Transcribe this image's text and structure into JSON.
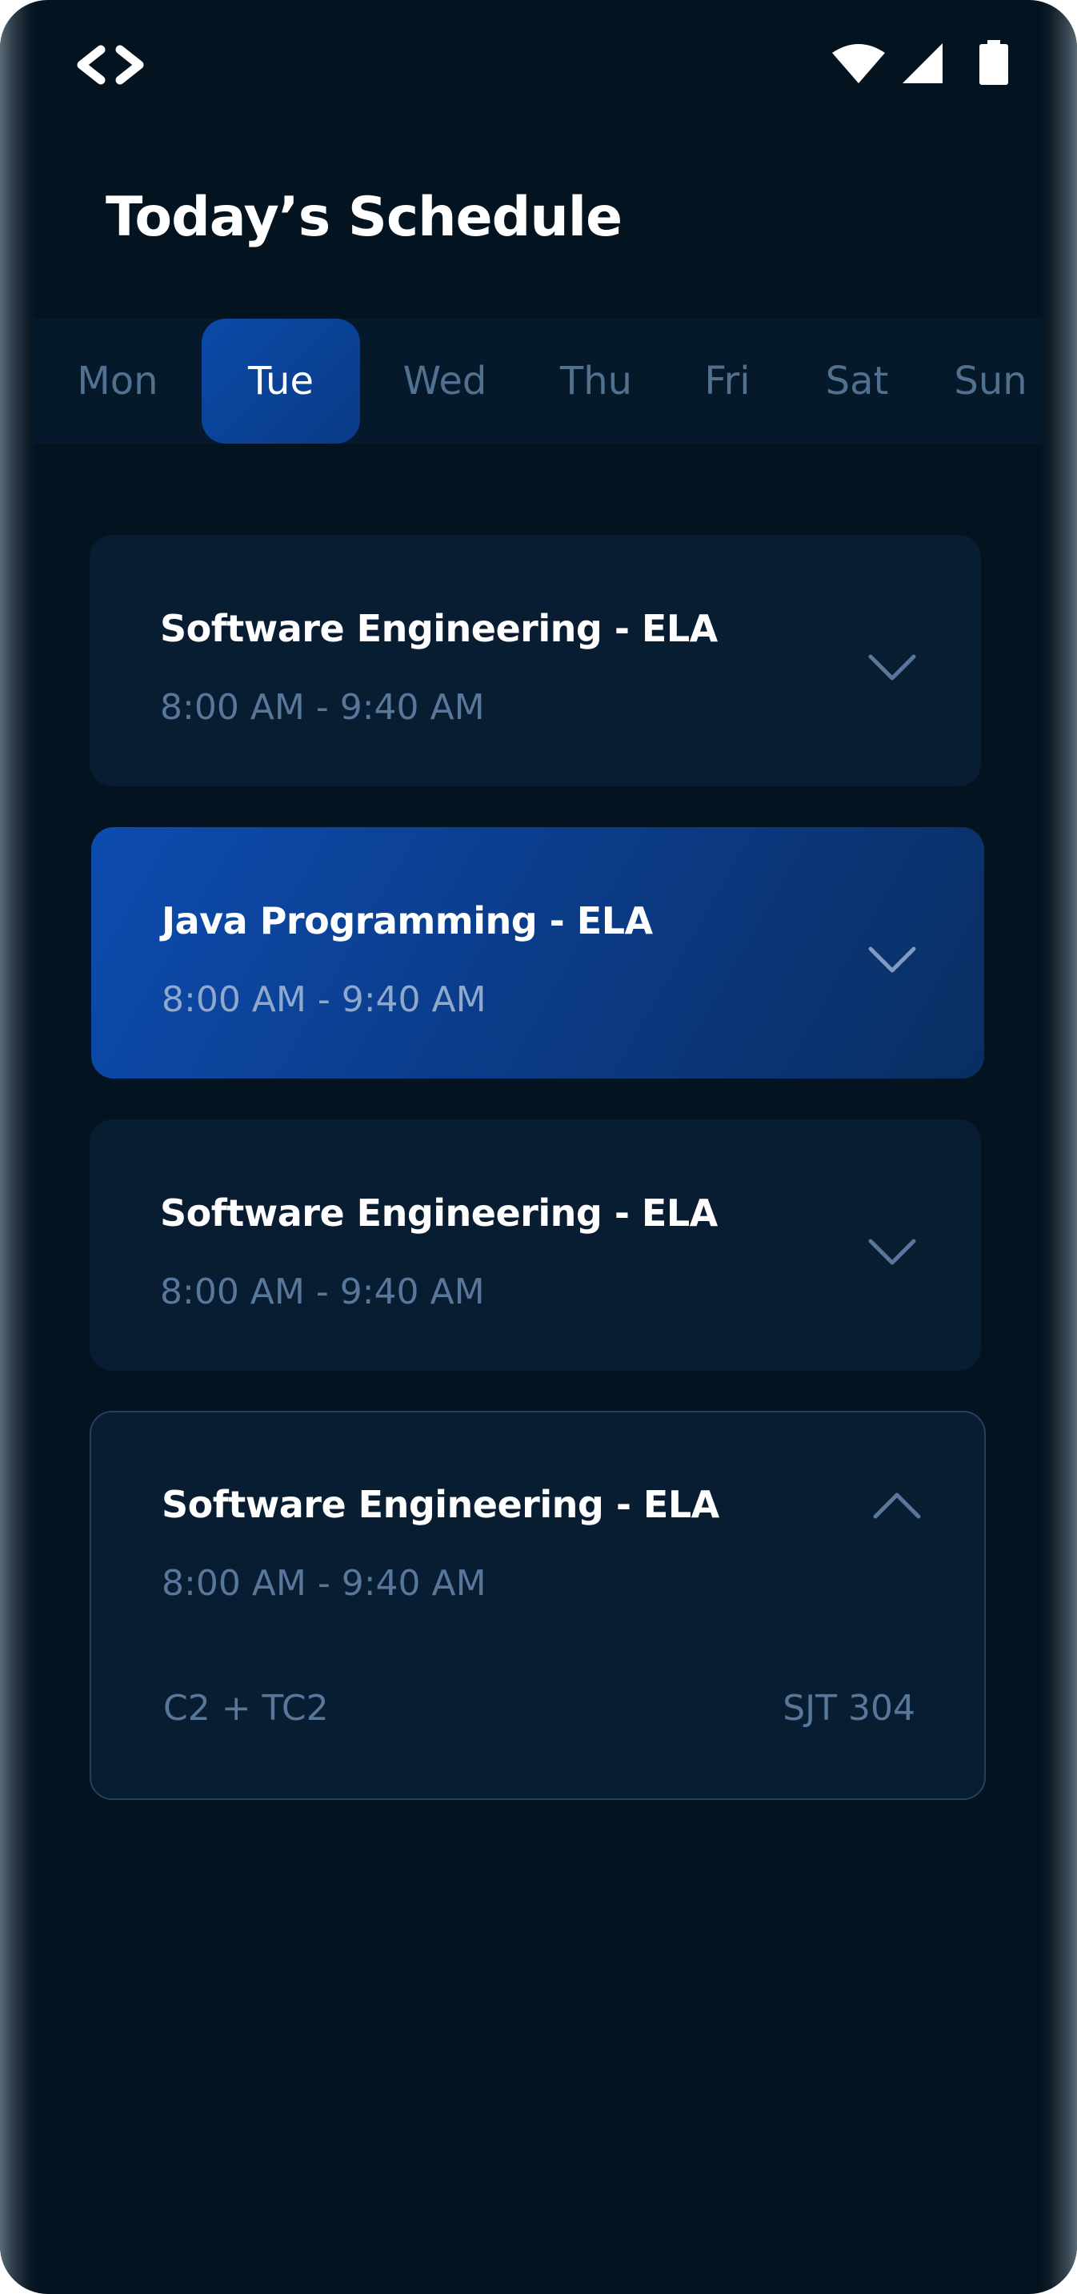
{
  "status_bar": {
    "left_icon": "code-brackets-icon",
    "right_icons": [
      "wifi-icon",
      "signal-icon",
      "battery-icon"
    ]
  },
  "header": {
    "title": "Today’s Schedule"
  },
  "days": {
    "items": [
      "Mon",
      "Tue",
      "Wed",
      "Thu",
      "Fri",
      "Sat",
      "Sun"
    ],
    "selected": "Tue"
  },
  "classes": [
    {
      "title": "Software Engineering - ELA",
      "time": "8:00 AM - 9:40 AM",
      "state": "collapsed",
      "icon": "chevron-down-icon"
    },
    {
      "title": "Java Programming - ELA",
      "time": "8:00 AM - 9:40 AM",
      "state": "selected",
      "icon": "chevron-down-icon"
    },
    {
      "title": "Software Engineering - ELA",
      "time": "8:00 AM - 9:40 AM",
      "state": "collapsed",
      "icon": "chevron-down-icon"
    },
    {
      "title": "Software Engineering - ELA",
      "time": "8:00 AM - 9:40 AM",
      "state": "expanded",
      "icon": "chevron-up-icon",
      "slot": "C2 + TC2",
      "room": "SJT 304"
    }
  ],
  "colors": {
    "background": "#03131f",
    "accent": "#0b4aa8",
    "card": "#081d31",
    "muted_text": "#58779a"
  }
}
